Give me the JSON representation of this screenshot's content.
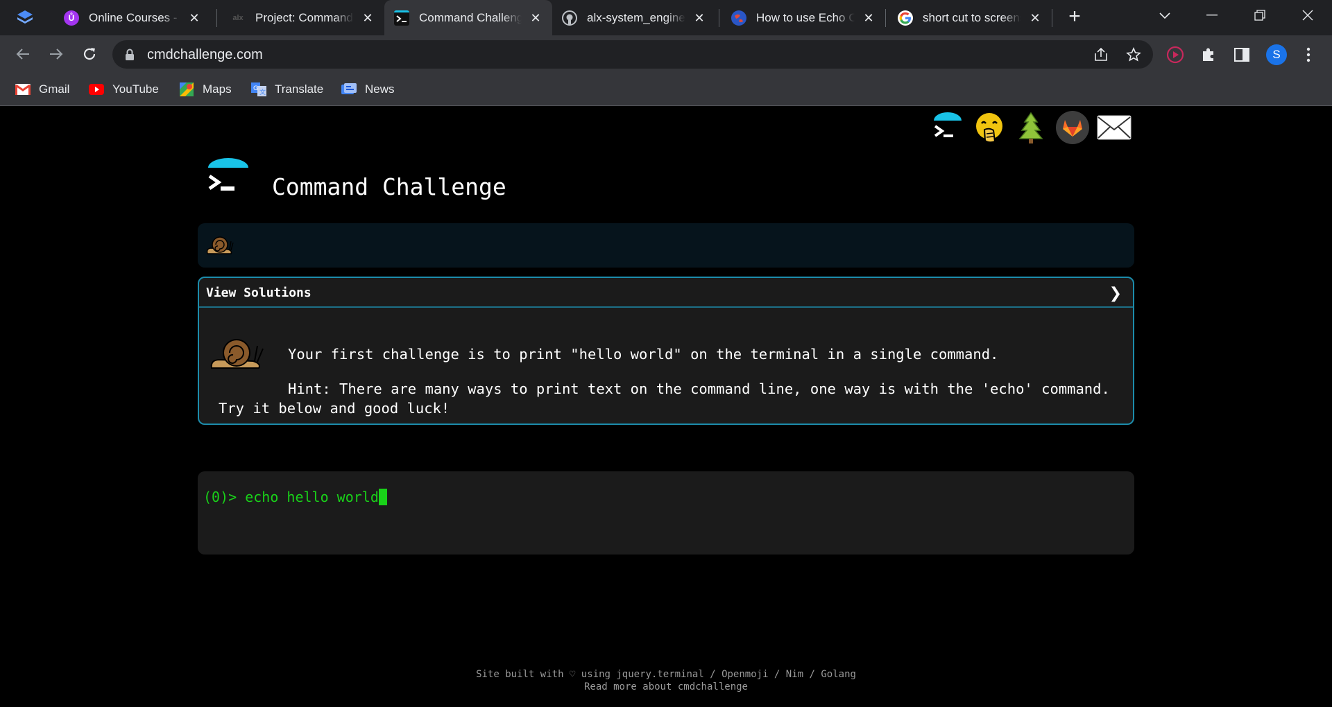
{
  "browser": {
    "tabs": [
      {
        "title": "Online Courses - Learn",
        "favicon_icon": "udemy-icon",
        "active": false
      },
      {
        "title": "Project: Command line",
        "favicon_icon": "alx-icon",
        "active": false
      },
      {
        "title": "Command Challenge",
        "favicon_icon": "terminal-icon",
        "active": true
      },
      {
        "title": "alx-system_engineering",
        "favicon_icon": "github-icon",
        "active": false
      },
      {
        "title": "How to use Echo Command",
        "favicon_icon": "globe-icon",
        "active": false
      },
      {
        "title": "short cut to screenshot",
        "favicon_icon": "google-icon",
        "active": false
      }
    ],
    "close_glyph": "✕",
    "url": "cmdchallenge.com",
    "profile_initial": "S",
    "bookmarks": [
      {
        "label": "Gmail",
        "icon": "gmail-icon"
      },
      {
        "label": "YouTube",
        "icon": "youtube-icon"
      },
      {
        "label": "Maps",
        "icon": "maps-icon"
      },
      {
        "label": "Translate",
        "icon": "translate-icon"
      },
      {
        "label": "News",
        "icon": "news-icon"
      }
    ]
  },
  "page": {
    "title": "Command Challenge",
    "view_solutions_label": "View Solutions",
    "chevron": "❯",
    "challenge_text": "Your first challenge is to print \"hello world\" on the terminal in a single command.",
    "hint_text": "Hint: There are many ways to print text on the command line, one way is with the 'echo' command. Try it below and good luck!",
    "prompt": "(0)> ",
    "command": "echo hello world",
    "footer_line1": "Site built with ♡ using jquery.terminal / Openmoji / Nim / Golang",
    "footer_line2": "Read more about cmdchallenge"
  },
  "colors": {
    "accent": "#1c8cab",
    "terminal_green": "#19d219",
    "logo_cyan": "#19c3e8"
  }
}
